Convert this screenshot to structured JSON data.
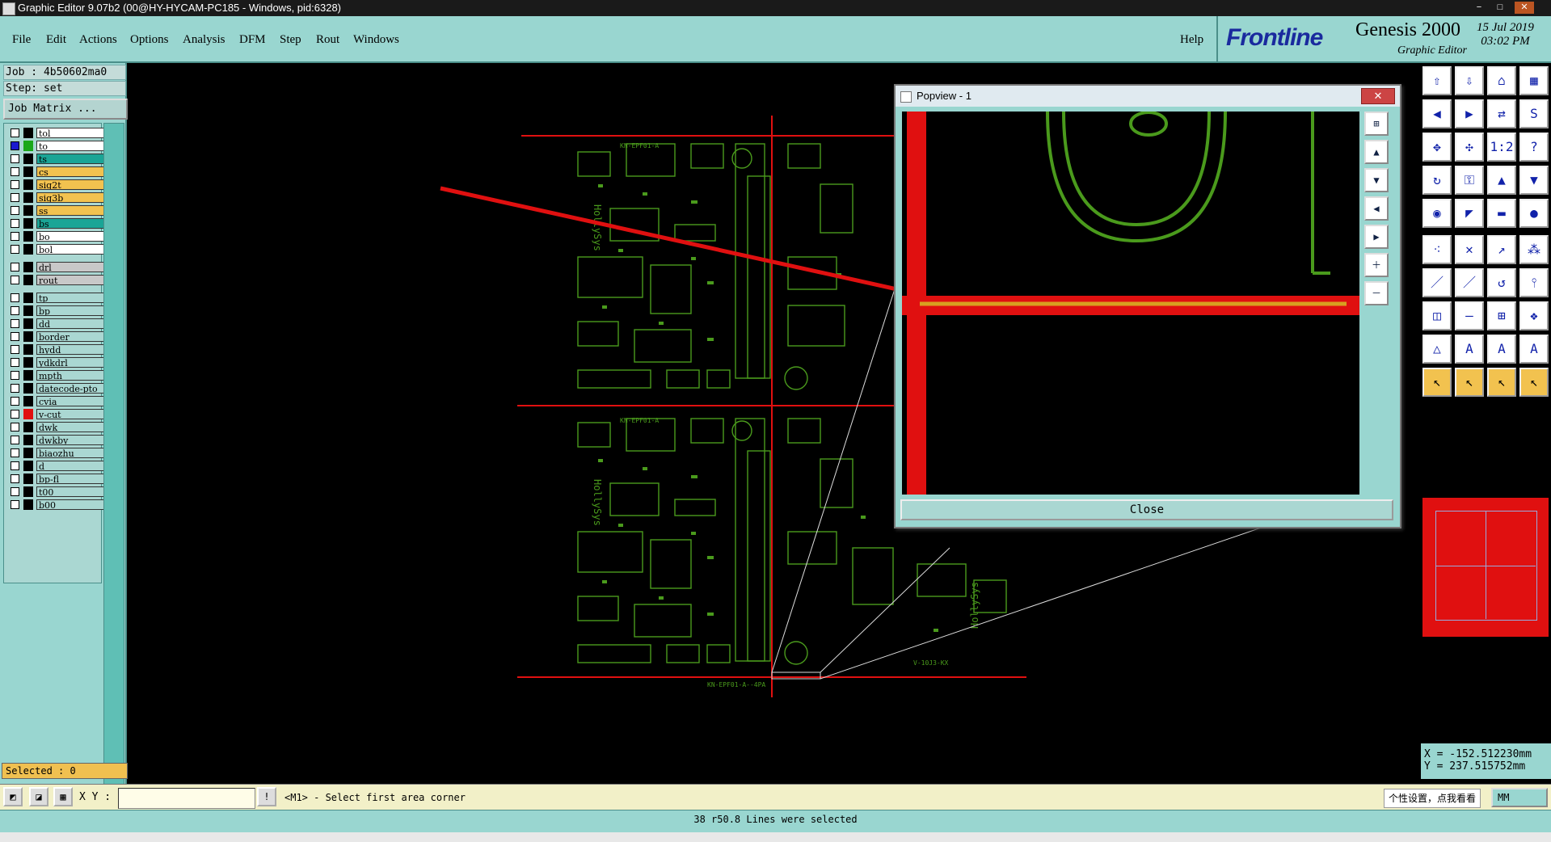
{
  "window": {
    "title": "Graphic Editor 9.07b2 (00@HY-HYCAM-PC185 - Windows, pid:6328)",
    "minimize": "−",
    "maximize": "□",
    "close": "✕"
  },
  "menu": {
    "items": [
      "File",
      "Edit",
      "Actions",
      "Options",
      "Analysis",
      "DFM",
      "Step",
      "Rout",
      "Windows"
    ],
    "help": "Help"
  },
  "brand": {
    "logo": "Frontline",
    "product": "Genesis 2000",
    "subtitle": "Graphic Editor",
    "date": "15 Jul 2019",
    "time": "03:02 PM"
  },
  "job": {
    "job_line": "Job : 4b50602ma0",
    "step_line": "Step: set",
    "matrix_button": "Job Matrix ..."
  },
  "layers": [
    {
      "name": "tol",
      "color": "#ffffff",
      "swatch": "#000000"
    },
    {
      "name": "to",
      "color": "#ffffff",
      "swatch": "#1aa81a",
      "active": true
    },
    {
      "name": "ts",
      "color": "#1aa596",
      "swatch": "#000000"
    },
    {
      "name": "cs",
      "color": "#f2c24f",
      "swatch": "#000000"
    },
    {
      "name": "sig2t",
      "color": "#f2c24f",
      "swatch": "#000000"
    },
    {
      "name": "sig3b",
      "color": "#f2c24f",
      "swatch": "#000000"
    },
    {
      "name": "ss",
      "color": "#f2c24f",
      "swatch": "#000000"
    },
    {
      "name": "bs",
      "color": "#1aa596",
      "swatch": "#000000"
    },
    {
      "name": "bo",
      "color": "#ffffff",
      "swatch": "#000000"
    },
    {
      "name": "bol",
      "color": "#ffffff",
      "swatch": "#000000"
    },
    {
      "name": "drl",
      "color": "#c8c8c8",
      "swatch": "#000000"
    },
    {
      "name": "rout",
      "color": "#c8c8c8",
      "swatch": "#000000"
    },
    {
      "name": "tp",
      "color": "#aad7d2",
      "swatch": "#000000"
    },
    {
      "name": "bp",
      "color": "#aad7d2",
      "swatch": "#000000"
    },
    {
      "name": "dd",
      "color": "#aad7d2",
      "swatch": "#000000"
    },
    {
      "name": "border",
      "color": "#aad7d2",
      "swatch": "#000000"
    },
    {
      "name": "hydd",
      "color": "#aad7d2",
      "swatch": "#000000"
    },
    {
      "name": "ydkdrl",
      "color": "#aad7d2",
      "swatch": "#000000"
    },
    {
      "name": "mpth",
      "color": "#aad7d2",
      "swatch": "#000000"
    },
    {
      "name": "datecode-pto",
      "color": "#aad7d2",
      "swatch": "#000000"
    },
    {
      "name": "cvia",
      "color": "#aad7d2",
      "swatch": "#000000"
    },
    {
      "name": "v-cut",
      "color": "#aad7d2",
      "swatch": "#e01010"
    },
    {
      "name": "dwk",
      "color": "#aad7d2",
      "swatch": "#000000"
    },
    {
      "name": "dwkby",
      "color": "#aad7d2",
      "swatch": "#000000"
    },
    {
      "name": "biaozhu",
      "color": "#aad7d2",
      "swatch": "#000000"
    },
    {
      "name": "d",
      "color": "#aad7d2",
      "swatch": "#000000"
    },
    {
      "name": "bp-fl",
      "color": "#aad7d2",
      "swatch": "#000000"
    },
    {
      "name": "t00",
      "color": "#aad7d2",
      "swatch": "#000000"
    },
    {
      "name": "b00",
      "color": "#aad7d2",
      "swatch": "#000000"
    }
  ],
  "selected": "Selected : 0",
  "command": {
    "xy_label": "X Y :",
    "xy_value": "",
    "prompt": "<M1> - Select first area corner",
    "units": "MM"
  },
  "status": "38 r50.8 Lines were selected",
  "coords": {
    "x": "X = -152.512230mm",
    "y": "Y = 237.515752mm"
  },
  "popview": {
    "title": "Popview - 1",
    "close": "Close"
  },
  "canvas": {
    "label_top": "KN-EPF01-A",
    "label_bottom": "KN-EPF01-A--4PA",
    "brand_text": "HollySys",
    "side_label": "V-10J3-KX"
  },
  "tooltip": "个性设置，点我看看"
}
